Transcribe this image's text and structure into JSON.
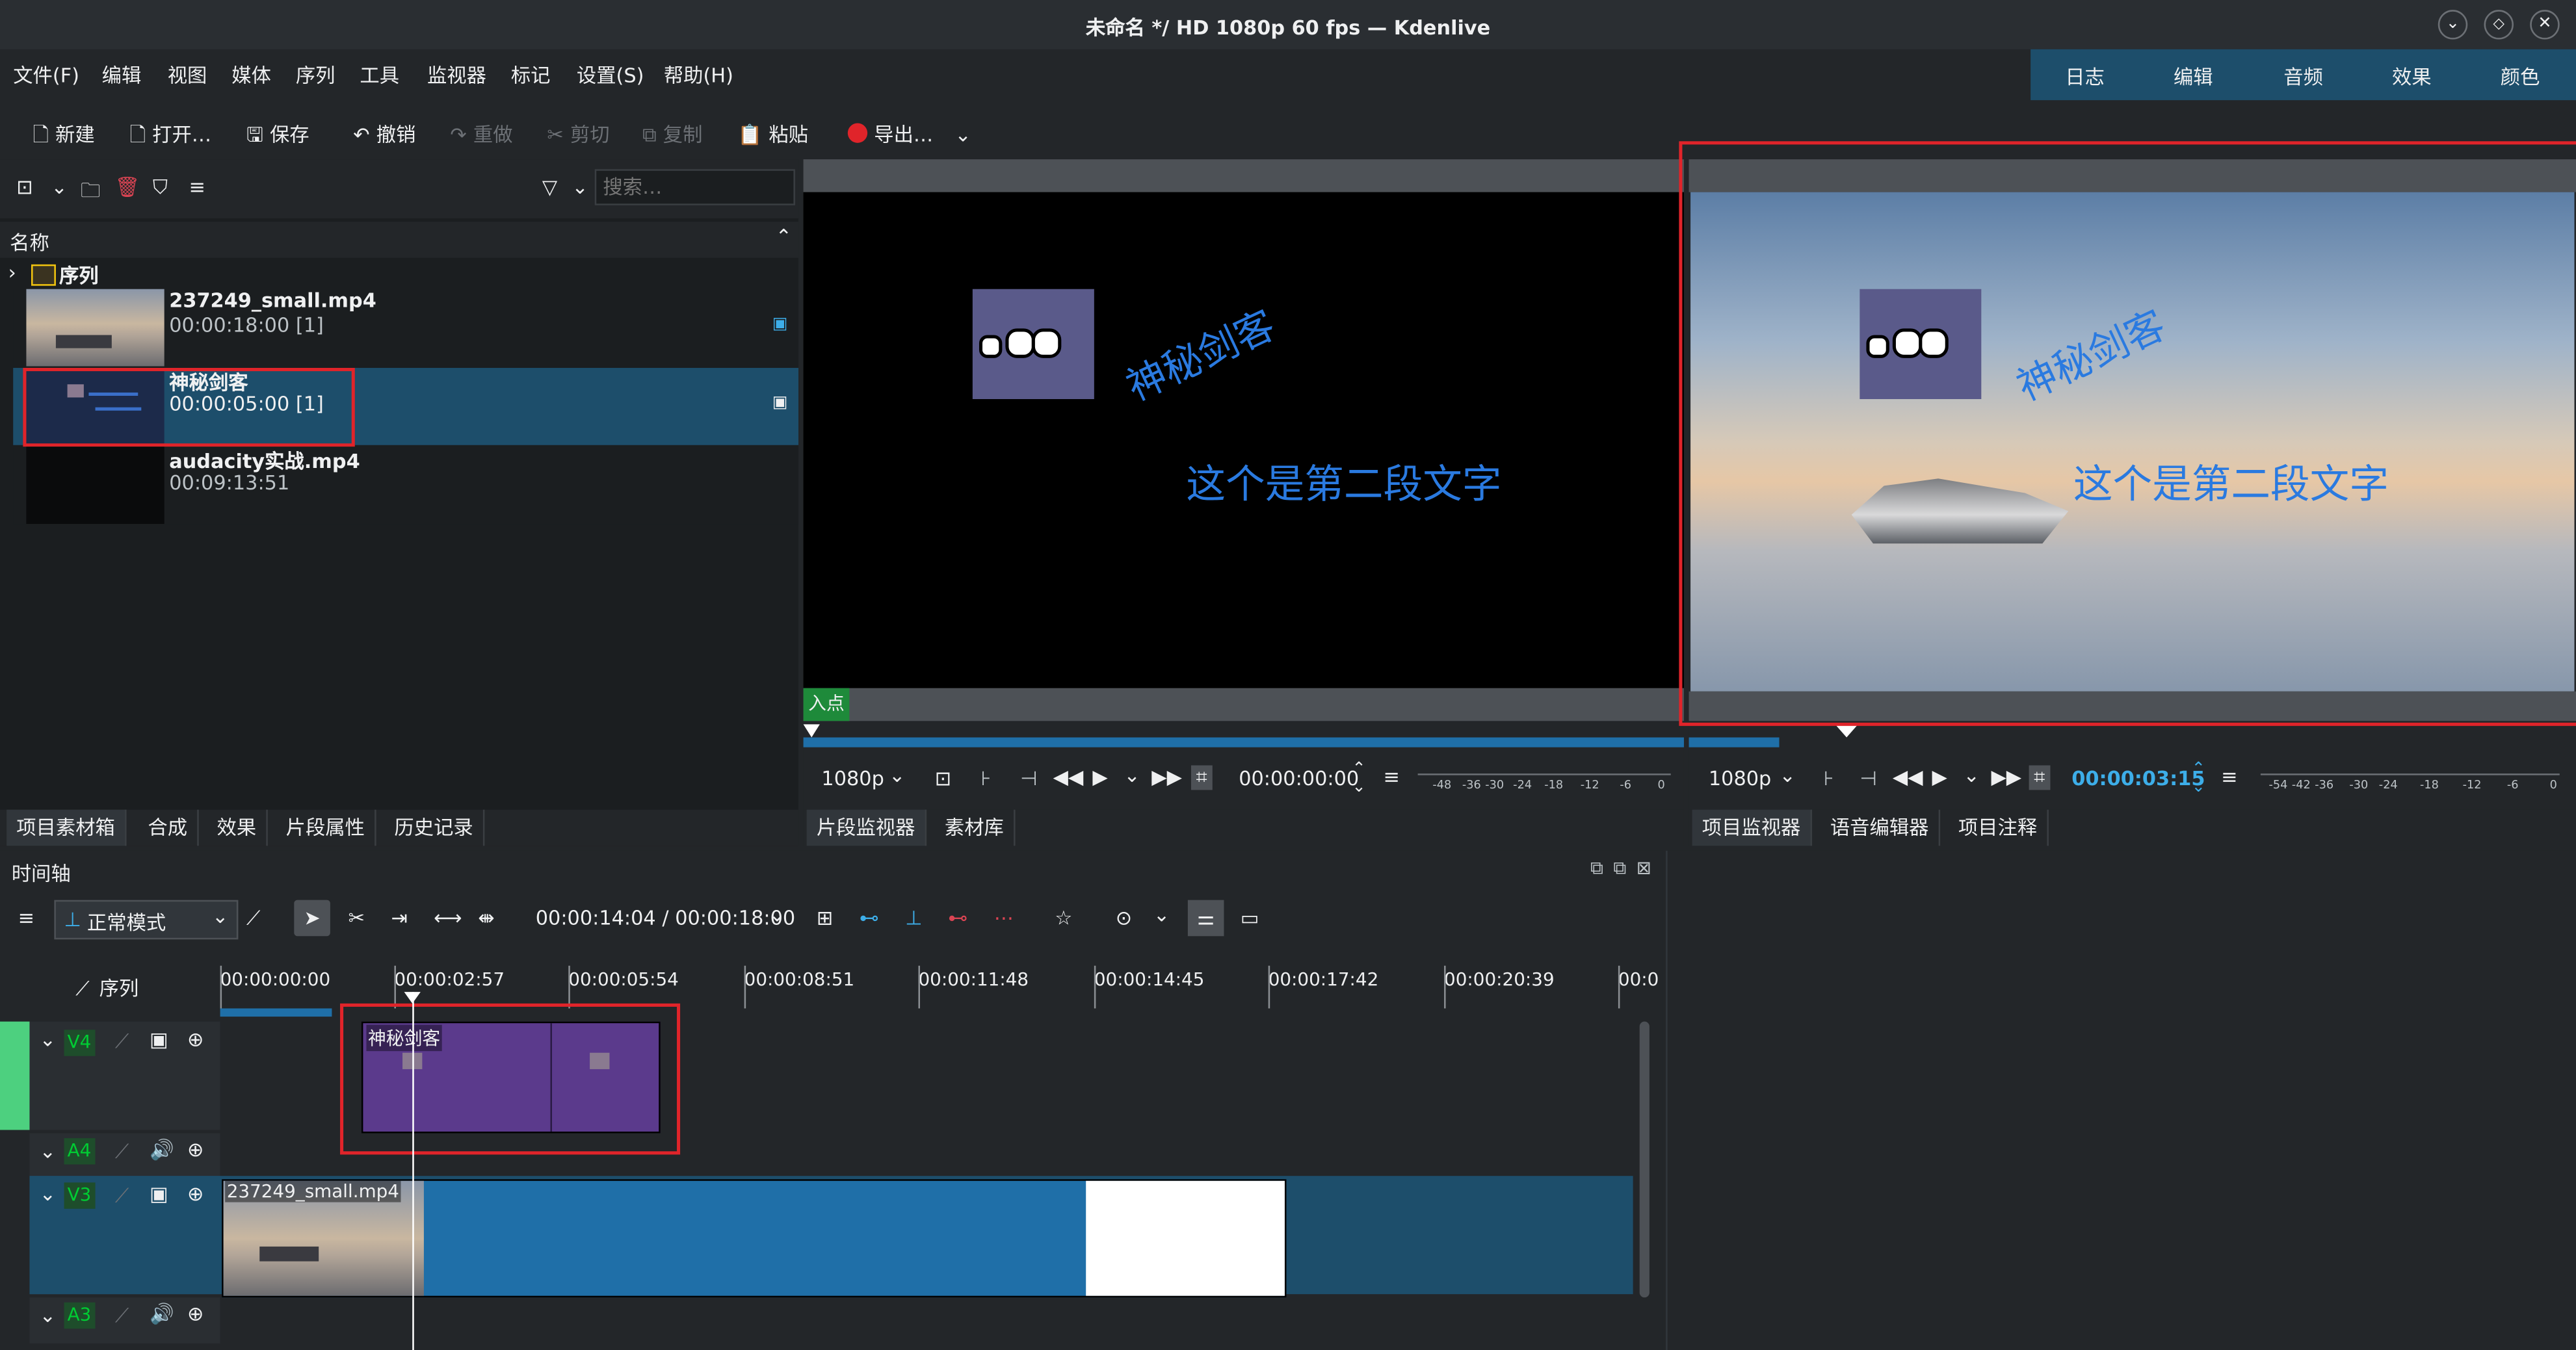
{
  "window": {
    "title": "未命名 */ HD 1080p 60 fps — Kdenlive"
  },
  "menubar": [
    "文件(F)",
    "编辑",
    "视图",
    "媒体",
    "序列",
    "工具",
    "监视器",
    "标记",
    "设置(S)",
    "帮助(H)"
  ],
  "workspace_tabs": [
    "日志",
    "编辑",
    "音频",
    "效果",
    "颜色"
  ],
  "toolbar": {
    "new": "新建",
    "open": "打开…",
    "save": "保存",
    "undo": "撤销",
    "redo": "重做",
    "cut": "剪切",
    "copy": "复制",
    "paste": "粘贴",
    "export": "导出…"
  },
  "bin": {
    "search_placeholder": "搜索…",
    "column_name": "名称",
    "folder": "序列",
    "items": [
      {
        "name": "237249_small.mp4",
        "duration": "00:00:18:00 [1]"
      },
      {
        "name": "神秘剑客",
        "duration": "00:00:05:00 [1]"
      },
      {
        "name": "audacity实战.mp4",
        "duration": "00:09:13:51"
      }
    ],
    "tabs": [
      "项目素材箱",
      "合成",
      "效果",
      "片段属性",
      "历史记录"
    ]
  },
  "clip_monitor": {
    "title_text_1": "神秘剑客",
    "title_text_2": "这个是第二段文字",
    "in_point": "入点",
    "resolution": "1080p",
    "timecode": "00:00:00:00",
    "tabs": [
      "片段监视器",
      "素材库"
    ],
    "meter_labels": [
      "-48",
      "-36",
      "-30",
      "-24",
      "-18",
      "-12",
      "-6",
      "0"
    ]
  },
  "project_monitor": {
    "title_text_1": "神秘剑客",
    "title_text_2": "这个是第二段文字",
    "resolution": "1080p",
    "timecode": "00:00:03:15",
    "tabs": [
      "项目监视器",
      "语音编辑器",
      "项目注释"
    ],
    "meter_labels": [
      "-54",
      "-42",
      "-36",
      "-30",
      "-24",
      "-18",
      "-12",
      "-6",
      "0"
    ]
  },
  "timeline": {
    "title": "时间轴",
    "mode": "正常模式",
    "timecode": "00:00:14:04 / 00:00:18:00",
    "sequence_label": "序列",
    "ruler": [
      "00:00:00:00",
      "00:00:02:57",
      "00:00:05:54",
      "00:00:08:51",
      "00:00:11:48",
      "00:00:14:45",
      "00:00:17:42",
      "00:00:20:39",
      "00:0"
    ],
    "tracks": [
      {
        "name": "V4",
        "clip": "神秘剑客"
      },
      {
        "name": "A4"
      },
      {
        "name": "V3",
        "clip": "237249_small.mp4"
      },
      {
        "name": "A3"
      }
    ]
  },
  "colors": {
    "accent": "#3daee9",
    "highlight": "#e0242a",
    "title_clip": "#5b3a8c",
    "video_clip": "#1f6fa8",
    "selection": "#1d4e6b"
  }
}
